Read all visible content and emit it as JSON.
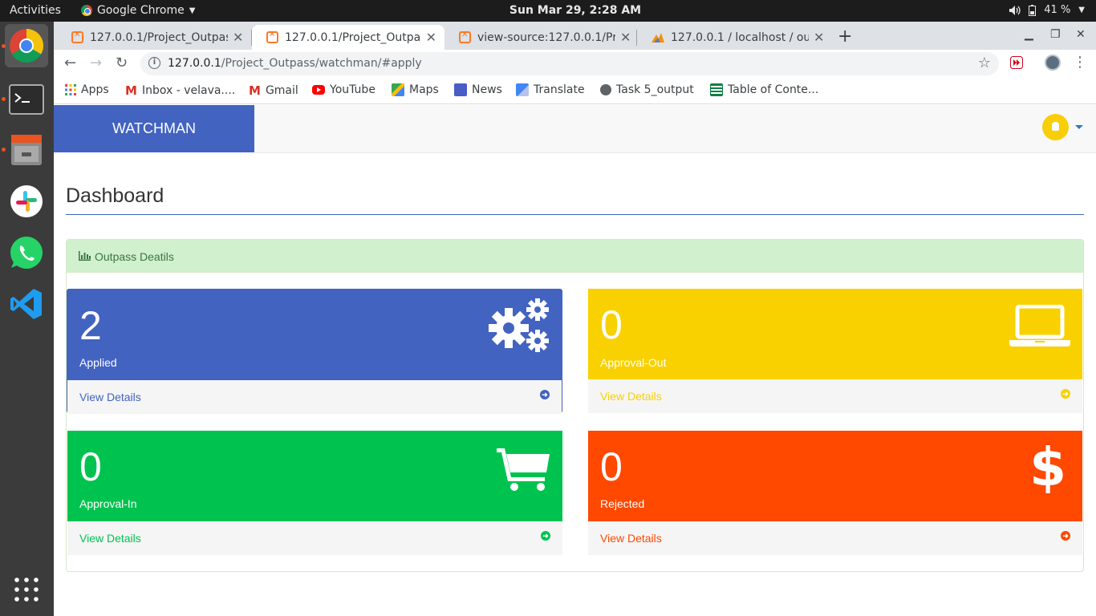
{
  "os_topbar": {
    "activities": "Activities",
    "app_menu": "Google Chrome",
    "clock": "Sun Mar 29,  2:28 AM",
    "battery": "41 %"
  },
  "dock": {
    "items": [
      "chrome-icon",
      "terminal-icon",
      "files-icon",
      "slack-icon",
      "whatsapp-icon",
      "vscode-icon",
      "app-grid-icon"
    ]
  },
  "browser": {
    "tabs": [
      {
        "title": "127.0.0.1/Project_Outpass"
      },
      {
        "title": "127.0.0.1/Project_Outpass"
      },
      {
        "title": "view-source:127.0.0.1/Pro"
      },
      {
        "title": "127.0.0.1 / localhost / outp"
      }
    ],
    "url_host": "127.0.0.1",
    "url_path": "/Project_Outpass/watchman/#apply",
    "bookmarks": [
      "Apps",
      "Inbox - velava....",
      "Gmail",
      "YouTube",
      "Maps",
      "News",
      "Translate",
      "Task 5_output",
      "Table of Conte..."
    ]
  },
  "app": {
    "brand": "WATCHMAN",
    "page_title": "Dashboard",
    "panel_title": "Outpass Deatils",
    "cards": [
      {
        "count": "2",
        "label": "Applied",
        "link": "View Details",
        "color": "#4263c0",
        "icon": "gears-icon"
      },
      {
        "count": "0",
        "label": "Approval-Out",
        "link": "View Details",
        "color": "#f9d100",
        "icon": "laptop-icon"
      },
      {
        "count": "0",
        "label": "Approval-In",
        "link": "View Details",
        "color": "#00c34f",
        "icon": "cart-icon"
      },
      {
        "count": "0",
        "label": "Rejected",
        "link": "View Details",
        "color": "#ff4800",
        "icon": "dollar-icon"
      }
    ]
  }
}
